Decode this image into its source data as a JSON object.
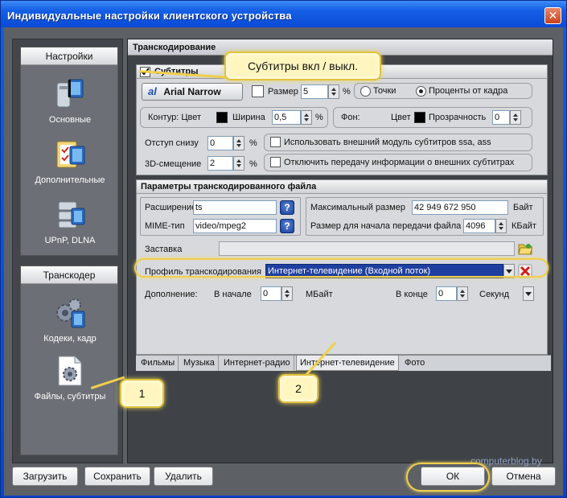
{
  "window": {
    "title": "Индивидуальные настройки клиентского устройства",
    "close_glyph": "✕"
  },
  "left": {
    "settings_header": "Настройки",
    "items": [
      {
        "label": "Основные",
        "icon": "device-icon"
      },
      {
        "label": "Дополнительные",
        "icon": "clipboard-icon"
      },
      {
        "label": "UPnP, DLNA",
        "icon": "server-icon"
      }
    ],
    "transcoder_header": "Транскодер",
    "transcoder_items": [
      {
        "label": "Кодеки, кадр",
        "icon": "gears-film-icon"
      },
      {
        "label": "Файлы, субтитры",
        "icon": "file-gear-icon"
      }
    ]
  },
  "right": {
    "header": "Транскодирование",
    "subtitles": {
      "title": "Субтитры",
      "checked": true,
      "font_name": "Arial Narrow",
      "size_label": "Размер",
      "size_value": "5",
      "percent": "%",
      "points_label": "Точки",
      "percent_frame_label": "Проценты от кадра",
      "selected_unit": "percent_frame",
      "outline_label": "Контур: Цвет",
      "width_label": "Ширина",
      "width_value": "0,5",
      "background_label": "Фон:",
      "bg_color_label": "Цвет",
      "transparency_label": "Прозрачность",
      "transparency_value": "0",
      "bottom_offset_label": "Отступ снизу",
      "bottom_offset_value": "0",
      "offset3d_label": "3D-смещение",
      "offset3d_value": "2",
      "external_module_label": "Использовать внешний модуль субтитров ssa, ass",
      "disable_external_label": "Отключить передачу информации о внешних субтитрах"
    },
    "params": {
      "title": "Параметры транскодированного файла",
      "extension_label": "Расширение",
      "extension_value": "ts",
      "mime_label": "MIME-тип",
      "mime_value": "video/mpeg2",
      "max_size_label": "Максимальный размер",
      "max_size_value": "42 949 672 950",
      "max_size_unit": "Байт",
      "start_size_label": "Размер для начала передачи файла",
      "start_size_value": "4096",
      "start_size_unit": "КБайт",
      "splash_label": "Заставка",
      "splash_value": "",
      "profile_label": "Профиль транскодирования",
      "profile_value": "Интернет-телевидение (Входной поток)",
      "addition_label": "Дополнение:",
      "start_label": "В начале",
      "start_value": "0",
      "start_unit": "МБайт",
      "end_label": "В конце",
      "end_value": "0",
      "end_unit": "Секунд"
    },
    "tabs": [
      "Фильмы",
      "Музыка",
      "Интернет-радио",
      "Интернет-телевидение",
      "Фото"
    ],
    "active_tab": 3
  },
  "bottom": {
    "load": "Загрузить",
    "save": "Сохранить",
    "delete": "Удалить",
    "ok": "ОК",
    "cancel": "Отмена"
  },
  "annotations": {
    "callout_subtitles": "Субтитры вкл / выкл.",
    "callout_1": "1",
    "callout_2": "2"
  },
  "watermark": "computerblog.by",
  "colors": {
    "accent": "#0b5fe8",
    "highlight": "#f0cf4a",
    "selection": "#1f3fa0"
  }
}
